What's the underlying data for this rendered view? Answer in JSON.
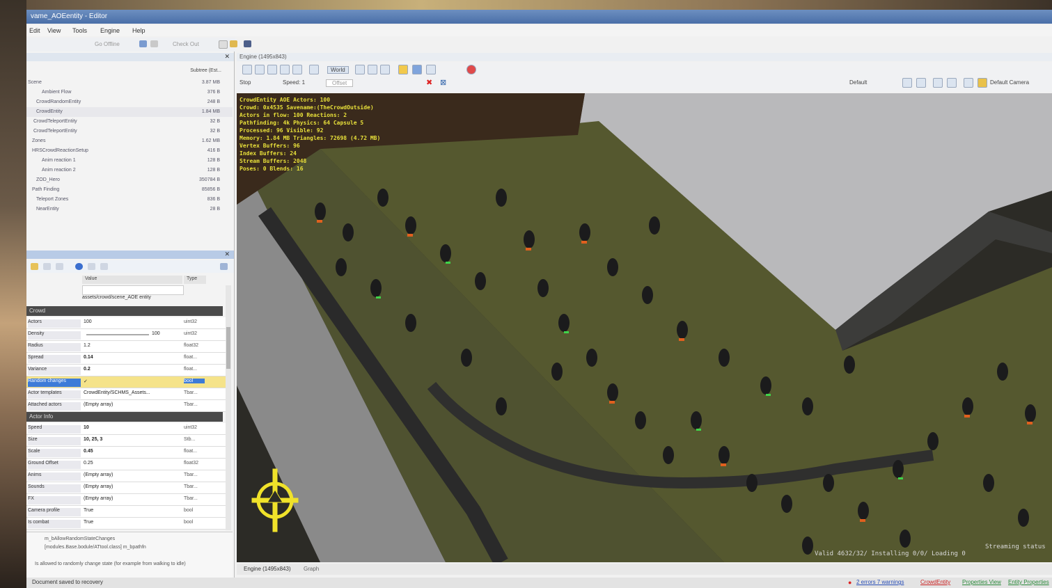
{
  "window": {
    "title": "vame_AOEentity - Editor"
  },
  "menu": [
    {
      "label": "Edit"
    },
    {
      "label": "View"
    },
    {
      "label": "Tools"
    },
    {
      "label": "Engine"
    },
    {
      "label": "Help"
    }
  ],
  "toolbar": {
    "go_offline": "Go Offline",
    "check_out": "Check Out"
  },
  "memory_panel": {
    "column_header": "Subtree (Est...",
    "rows": [
      {
        "name": "Scene",
        "value": "3.87 MB"
      },
      {
        "name": "Ambient Flow",
        "value": "376 B"
      },
      {
        "name": "CrowdRandomEntity",
        "value": "248 B"
      },
      {
        "name": "CrowdEntity",
        "value": "1.84 MB"
      },
      {
        "name": "CrowdTeleportEntity",
        "value": "32 B"
      },
      {
        "name": "CrowdTeleportEntity",
        "value": "32 B"
      },
      {
        "name": "Zones",
        "value": "1.62 MB"
      },
      {
        "name": "HRSCrowdReactionSetup",
        "value": "416 B"
      },
      {
        "name": "Anim reaction 1",
        "value": "128 B"
      },
      {
        "name": "Anim reaction 2",
        "value": "128 B"
      },
      {
        "name": "ZOD_Hero",
        "value": "350784 B"
      },
      {
        "name": "Path Finding",
        "value": "85856 B"
      },
      {
        "name": "Teleport Zones",
        "value": "836 B"
      },
      {
        "name": "NearEntity",
        "value": "28 B"
      }
    ]
  },
  "property_grid": {
    "col_value": "Value",
    "col_type": "Type",
    "path_value": "assets/crowd/scene_AOE entity",
    "categories": [
      {
        "label": "Crowd"
      },
      {
        "label": "Actor Info"
      }
    ],
    "rows_a": [
      {
        "name": "Actors",
        "value": "100",
        "type": "uint32"
      },
      {
        "name": "Density",
        "value": "100",
        "type": "uint32"
      },
      {
        "name": "Radius",
        "value": "1.2",
        "type": "float32"
      },
      {
        "name": "Spread",
        "value": "0.14",
        "type": "float..."
      },
      {
        "name": "Variance",
        "value": "0.2",
        "type": "float..."
      },
      {
        "name": "Random changes",
        "value": "✓",
        "type": "bool"
      },
      {
        "name": "Actor templates",
        "value": "CrowdEntity/SCHMS_Assets...",
        "type": "Tbar..."
      },
      {
        "name": "Attached actors",
        "value": "(Empty array)",
        "type": "Tbar..."
      }
    ],
    "rows_b": [
      {
        "name": "Speed",
        "value": "10",
        "type": "uint32"
      },
      {
        "name": "Size",
        "value": "10, 25, 3",
        "type": "Stb..."
      },
      {
        "name": "Scale",
        "value": "0.45",
        "type": "float..."
      },
      {
        "name": "Ground Offset",
        "value": "0.25",
        "type": "float32"
      },
      {
        "name": "Anims",
        "value": "(Empty array)",
        "type": "Tbar..."
      },
      {
        "name": "Sounds",
        "value": "(Empty array)",
        "type": "Tbar..."
      },
      {
        "name": "FX",
        "value": "(Empty array)",
        "type": "Tbar..."
      },
      {
        "name": "Camera profile",
        "value": "True",
        "type": "bool"
      },
      {
        "name": "Is combat",
        "value": "True",
        "type": "bool"
      }
    ],
    "desc_title": "m_bAllowRandomStateChanges",
    "desc_path": "[modules.Base.bodule/ATtool.class] m_bpathfn",
    "desc_text": "Is allowed to randomly change state (for example from walking to idle)"
  },
  "viewport": {
    "title": "Engine (1495x843)",
    "world_label": "World",
    "stop_label": "Stop",
    "speed_label": "Speed: 1",
    "offset_label": "Offset",
    "preset": "Default",
    "camera": "Default Camera",
    "debug_lines": [
      "CrowdEntity AOE  Actors: 100",
      "Crowd: 0x4535 Savename:(TheCrowdOutside)",
      "Actors in flow: 100  Reactions: 2",
      "Pathfinding: 4k  Physics: 64  Capsule 5",
      "Processed: 96  Visible: 92",
      "Memory: 1.84 MB  Triangles: 72698  (4.72 MB)",
      "Vertex Buffers: 96",
      "Index Buffers: 24",
      "Stream Buffers: 2048",
      "Poses: 0  Blends: 16"
    ],
    "overlay_bottom_right": "Valid 4632/32/  Installing 0/0/  Loading 0",
    "streaming": "Streaming status"
  },
  "bottom_tabs": {
    "engine": "Engine (1495x843)",
    "graph": "Graph"
  },
  "status": {
    "left": "Document saved to recovery",
    "errors": "2 errors 7 warnings",
    "crowd": "CrowdEntity",
    "prop_view": "Properties View",
    "entity_prop": "Entity Properties"
  }
}
